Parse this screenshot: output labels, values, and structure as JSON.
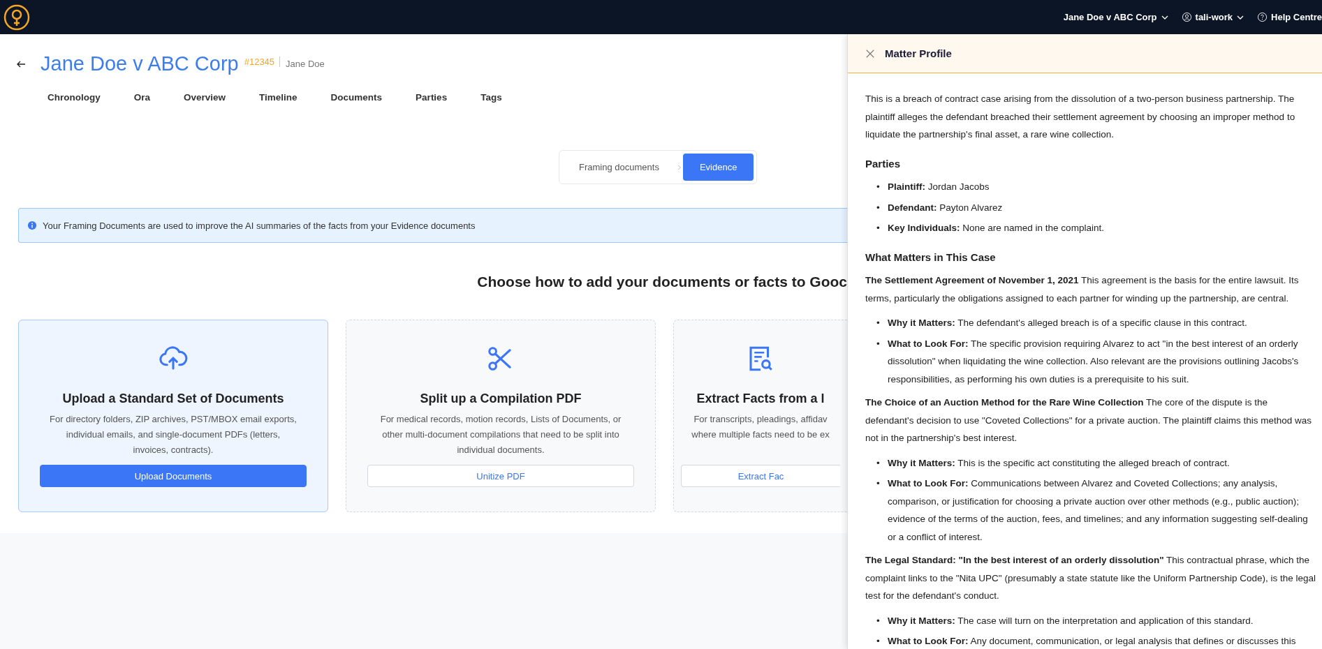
{
  "top_bar": {
    "matter_menu": "Jane Doe v ABC Corp",
    "user_menu": "tali-work",
    "help": "Help Centre"
  },
  "header": {
    "title": "Jane Doe v ABC Corp",
    "matter_number": "#12345",
    "client": "Jane Doe"
  },
  "tabs": [
    "Chronology",
    "Ora",
    "Overview",
    "Timeline",
    "Documents",
    "Parties",
    "Tags"
  ],
  "steps": [
    {
      "label": "Framing documents",
      "selected": false
    },
    {
      "label": "Evidence",
      "selected": true
    }
  ],
  "info_banner": "Your Framing Documents are used to improve the AI summaries of the facts from your Evidence documents",
  "heading": "Choose how to add your documents or facts to Gooc",
  "cards": [
    {
      "kind": "upload",
      "highlighted": true,
      "title": "Upload a Standard Set of Documents",
      "description_lines": [
        "For directory folders, ZIP archives, PST/MBOX email exports,",
        "individual emails, and single-document PDFs (letters,",
        "invoices, contracts)."
      ],
      "button": "Upload Documents"
    },
    {
      "kind": "split",
      "highlighted": false,
      "title": "Split up a Compilation PDF",
      "description_lines": [
        "For medical records, motion records, Lists of Documents, or",
        "other multi-document compilations that need to be split into",
        "individual documents."
      ],
      "button": "Unitize PDF"
    },
    {
      "kind": "extract",
      "highlighted": false,
      "title": "Extract Facts from a l",
      "description_lines": [
        "For transcripts, pleadings, affidav",
        "where multiple facts need to be ex"
      ],
      "button": "Extract Fac"
    }
  ],
  "panel": {
    "title": "Matter Profile",
    "blocks": [
      {
        "kind": "paragraph",
        "text": "This is a breach of contract case arising from the dissolution of a two-person business partnership. The plaintiff alleges the defendant breached their settlement agreement by choosing an improper method to liquidate the partnership's final asset, a rare wine collection."
      },
      {
        "kind": "heading",
        "text": "Parties"
      },
      {
        "kind": "bullets",
        "marker": "•",
        "items": [
          "**Plaintiff:** Jordan Jacobs",
          "**Defendant:** Payton Alvarez",
          "**Key Individuals:** None are named in the complaint."
        ]
      },
      {
        "kind": "heading",
        "text": "What Matters in This Case"
      },
      {
        "kind": "paragraph",
        "text": "**The Settlement Agreement of November 1, 2021** This agreement is the basis for the entire lawsuit. Its terms, particularly the obligations assigned to each partner for winding up the partnership, are central."
      },
      {
        "kind": "bullets",
        "marker": "•",
        "items": [
          "**Why it Matters:** The defendant's alleged breach is of a specific clause in this contract.",
          "**What to Look For:** The specific provision requiring Alvarez to act \"in the best interest of an orderly dissolution\" when liquidating the wine collection. Also relevant are the provisions outlining Jacobs's responsibilities, as performing his own duties is a prerequisite to his suit."
        ]
      },
      {
        "kind": "paragraph",
        "text": "**The Choice of an Auction Method for the Rare Wine Collection** The core of the dispute is the defendant's decision to use \"Coveted Collections\" for a private auction. The plaintiff claims this method was not in the partnership's best interest."
      },
      {
        "kind": "bullets",
        "marker": "•",
        "items": [
          "**Why it Matters:** This is the specific act constituting the alleged breach of contract.",
          "**What to Look For:** Communications between Alvarez and Coveted Collections; any analysis, comparison, or justification for choosing a private auction over other methods (e.g., public auction); evidence of the terms of the auction, fees, and timelines; and any information suggesting self-dealing or a conflict of interest."
        ]
      },
      {
        "kind": "paragraph",
        "text": "**The Legal Standard: \"In the best interest of an orderly dissolution\"** This contractual phrase, which the complaint links to the \"Nita UPC\" (presumably a state statute like the Uniform Partnership Code), is the legal test for the defendant's conduct."
      },
      {
        "kind": "bullets",
        "marker": "•",
        "items": [
          "**Why it Matters:** The case will turn on the interpretation and application of this standard.",
          "**What to Look For:** Any document, communication, or legal analysis that defines or discusses this"
        ]
      }
    ]
  }
}
